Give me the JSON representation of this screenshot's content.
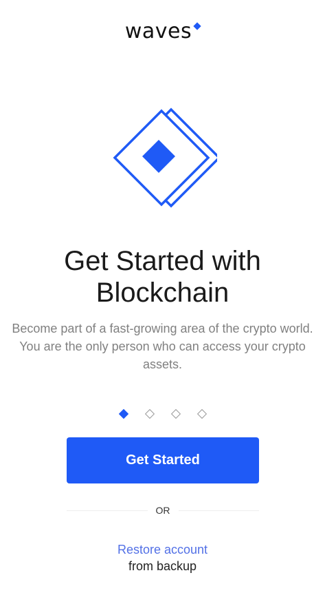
{
  "brand": {
    "name": "waves",
    "accent_color": "#1f5af6"
  },
  "onboarding": {
    "title": "Get Started with Blockchain",
    "description": "Become part of a fast-growing area of the crypto world. You are the only person who can access your crypto assets.",
    "pager": {
      "total": 4,
      "active_index": 1
    },
    "primary_button_label": "Get Started",
    "divider_label": "OR",
    "restore_link_label": "Restore account",
    "restore_sub_label": "from backup"
  }
}
